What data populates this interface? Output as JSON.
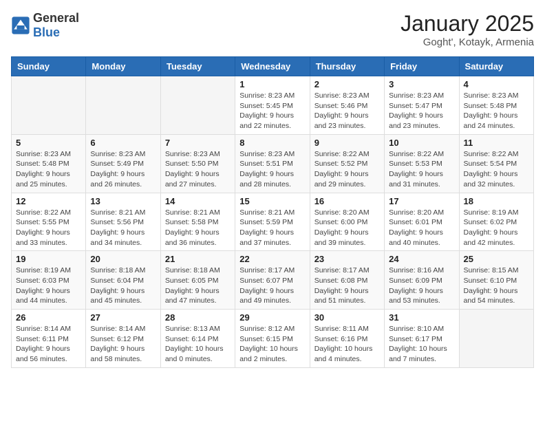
{
  "header": {
    "logo_general": "General",
    "logo_blue": "Blue",
    "month_title": "January 2025",
    "location": "Goght', Kotayk, Armenia"
  },
  "weekdays": [
    "Sunday",
    "Monday",
    "Tuesday",
    "Wednesday",
    "Thursday",
    "Friday",
    "Saturday"
  ],
  "weeks": [
    [
      {
        "day": "",
        "info": ""
      },
      {
        "day": "",
        "info": ""
      },
      {
        "day": "",
        "info": ""
      },
      {
        "day": "1",
        "info": "Sunrise: 8:23 AM\nSunset: 5:45 PM\nDaylight: 9 hours\nand 22 minutes."
      },
      {
        "day": "2",
        "info": "Sunrise: 8:23 AM\nSunset: 5:46 PM\nDaylight: 9 hours\nand 23 minutes."
      },
      {
        "day": "3",
        "info": "Sunrise: 8:23 AM\nSunset: 5:47 PM\nDaylight: 9 hours\nand 23 minutes."
      },
      {
        "day": "4",
        "info": "Sunrise: 8:23 AM\nSunset: 5:48 PM\nDaylight: 9 hours\nand 24 minutes."
      }
    ],
    [
      {
        "day": "5",
        "info": "Sunrise: 8:23 AM\nSunset: 5:48 PM\nDaylight: 9 hours\nand 25 minutes."
      },
      {
        "day": "6",
        "info": "Sunrise: 8:23 AM\nSunset: 5:49 PM\nDaylight: 9 hours\nand 26 minutes."
      },
      {
        "day": "7",
        "info": "Sunrise: 8:23 AM\nSunset: 5:50 PM\nDaylight: 9 hours\nand 27 minutes."
      },
      {
        "day": "8",
        "info": "Sunrise: 8:23 AM\nSunset: 5:51 PM\nDaylight: 9 hours\nand 28 minutes."
      },
      {
        "day": "9",
        "info": "Sunrise: 8:22 AM\nSunset: 5:52 PM\nDaylight: 9 hours\nand 29 minutes."
      },
      {
        "day": "10",
        "info": "Sunrise: 8:22 AM\nSunset: 5:53 PM\nDaylight: 9 hours\nand 31 minutes."
      },
      {
        "day": "11",
        "info": "Sunrise: 8:22 AM\nSunset: 5:54 PM\nDaylight: 9 hours\nand 32 minutes."
      }
    ],
    [
      {
        "day": "12",
        "info": "Sunrise: 8:22 AM\nSunset: 5:55 PM\nDaylight: 9 hours\nand 33 minutes."
      },
      {
        "day": "13",
        "info": "Sunrise: 8:21 AM\nSunset: 5:56 PM\nDaylight: 9 hours\nand 34 minutes."
      },
      {
        "day": "14",
        "info": "Sunrise: 8:21 AM\nSunset: 5:58 PM\nDaylight: 9 hours\nand 36 minutes."
      },
      {
        "day": "15",
        "info": "Sunrise: 8:21 AM\nSunset: 5:59 PM\nDaylight: 9 hours\nand 37 minutes."
      },
      {
        "day": "16",
        "info": "Sunrise: 8:20 AM\nSunset: 6:00 PM\nDaylight: 9 hours\nand 39 minutes."
      },
      {
        "day": "17",
        "info": "Sunrise: 8:20 AM\nSunset: 6:01 PM\nDaylight: 9 hours\nand 40 minutes."
      },
      {
        "day": "18",
        "info": "Sunrise: 8:19 AM\nSunset: 6:02 PM\nDaylight: 9 hours\nand 42 minutes."
      }
    ],
    [
      {
        "day": "19",
        "info": "Sunrise: 8:19 AM\nSunset: 6:03 PM\nDaylight: 9 hours\nand 44 minutes."
      },
      {
        "day": "20",
        "info": "Sunrise: 8:18 AM\nSunset: 6:04 PM\nDaylight: 9 hours\nand 45 minutes."
      },
      {
        "day": "21",
        "info": "Sunrise: 8:18 AM\nSunset: 6:05 PM\nDaylight: 9 hours\nand 47 minutes."
      },
      {
        "day": "22",
        "info": "Sunrise: 8:17 AM\nSunset: 6:07 PM\nDaylight: 9 hours\nand 49 minutes."
      },
      {
        "day": "23",
        "info": "Sunrise: 8:17 AM\nSunset: 6:08 PM\nDaylight: 9 hours\nand 51 minutes."
      },
      {
        "day": "24",
        "info": "Sunrise: 8:16 AM\nSunset: 6:09 PM\nDaylight: 9 hours\nand 53 minutes."
      },
      {
        "day": "25",
        "info": "Sunrise: 8:15 AM\nSunset: 6:10 PM\nDaylight: 9 hours\nand 54 minutes."
      }
    ],
    [
      {
        "day": "26",
        "info": "Sunrise: 8:14 AM\nSunset: 6:11 PM\nDaylight: 9 hours\nand 56 minutes."
      },
      {
        "day": "27",
        "info": "Sunrise: 8:14 AM\nSunset: 6:12 PM\nDaylight: 9 hours\nand 58 minutes."
      },
      {
        "day": "28",
        "info": "Sunrise: 8:13 AM\nSunset: 6:14 PM\nDaylight: 10 hours\nand 0 minutes."
      },
      {
        "day": "29",
        "info": "Sunrise: 8:12 AM\nSunset: 6:15 PM\nDaylight: 10 hours\nand 2 minutes."
      },
      {
        "day": "30",
        "info": "Sunrise: 8:11 AM\nSunset: 6:16 PM\nDaylight: 10 hours\nand 4 minutes."
      },
      {
        "day": "31",
        "info": "Sunrise: 8:10 AM\nSunset: 6:17 PM\nDaylight: 10 hours\nand 7 minutes."
      },
      {
        "day": "",
        "info": ""
      }
    ]
  ]
}
